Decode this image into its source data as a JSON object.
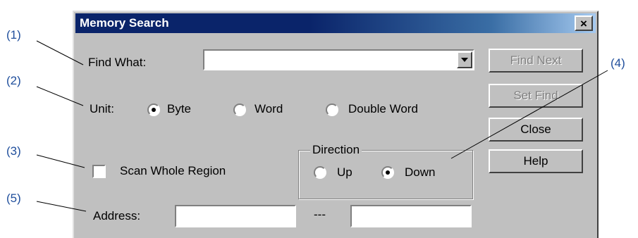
{
  "callouts": [
    "(1)",
    "(2)",
    "(3)",
    "(4)",
    "(5)"
  ],
  "dialog": {
    "title": "Memory Search",
    "close_glyph": "×"
  },
  "find_what": {
    "label": "Find What:",
    "value": ""
  },
  "unit": {
    "label": "Unit:",
    "options": [
      "Byte",
      "Word",
      "Double Word"
    ],
    "selected": "Byte"
  },
  "scan_whole_region": {
    "label": "Scan Whole Region",
    "checked": false
  },
  "direction": {
    "legend": "Direction",
    "options": [
      "Up",
      "Down"
    ],
    "selected": "Down"
  },
  "address": {
    "label": "Address:",
    "separator": "---",
    "from": "",
    "to": ""
  },
  "buttons": {
    "find_next": "Find Next",
    "set_find": "Set Find",
    "close": "Close",
    "help": "Help"
  },
  "colors": {
    "title_bar": "#0a246a",
    "dialog_face": "#c0c0c0",
    "callout_text": "#1f4e9c"
  },
  "icons": {
    "dropdown": "chevron-down-icon",
    "close": "close-icon"
  }
}
